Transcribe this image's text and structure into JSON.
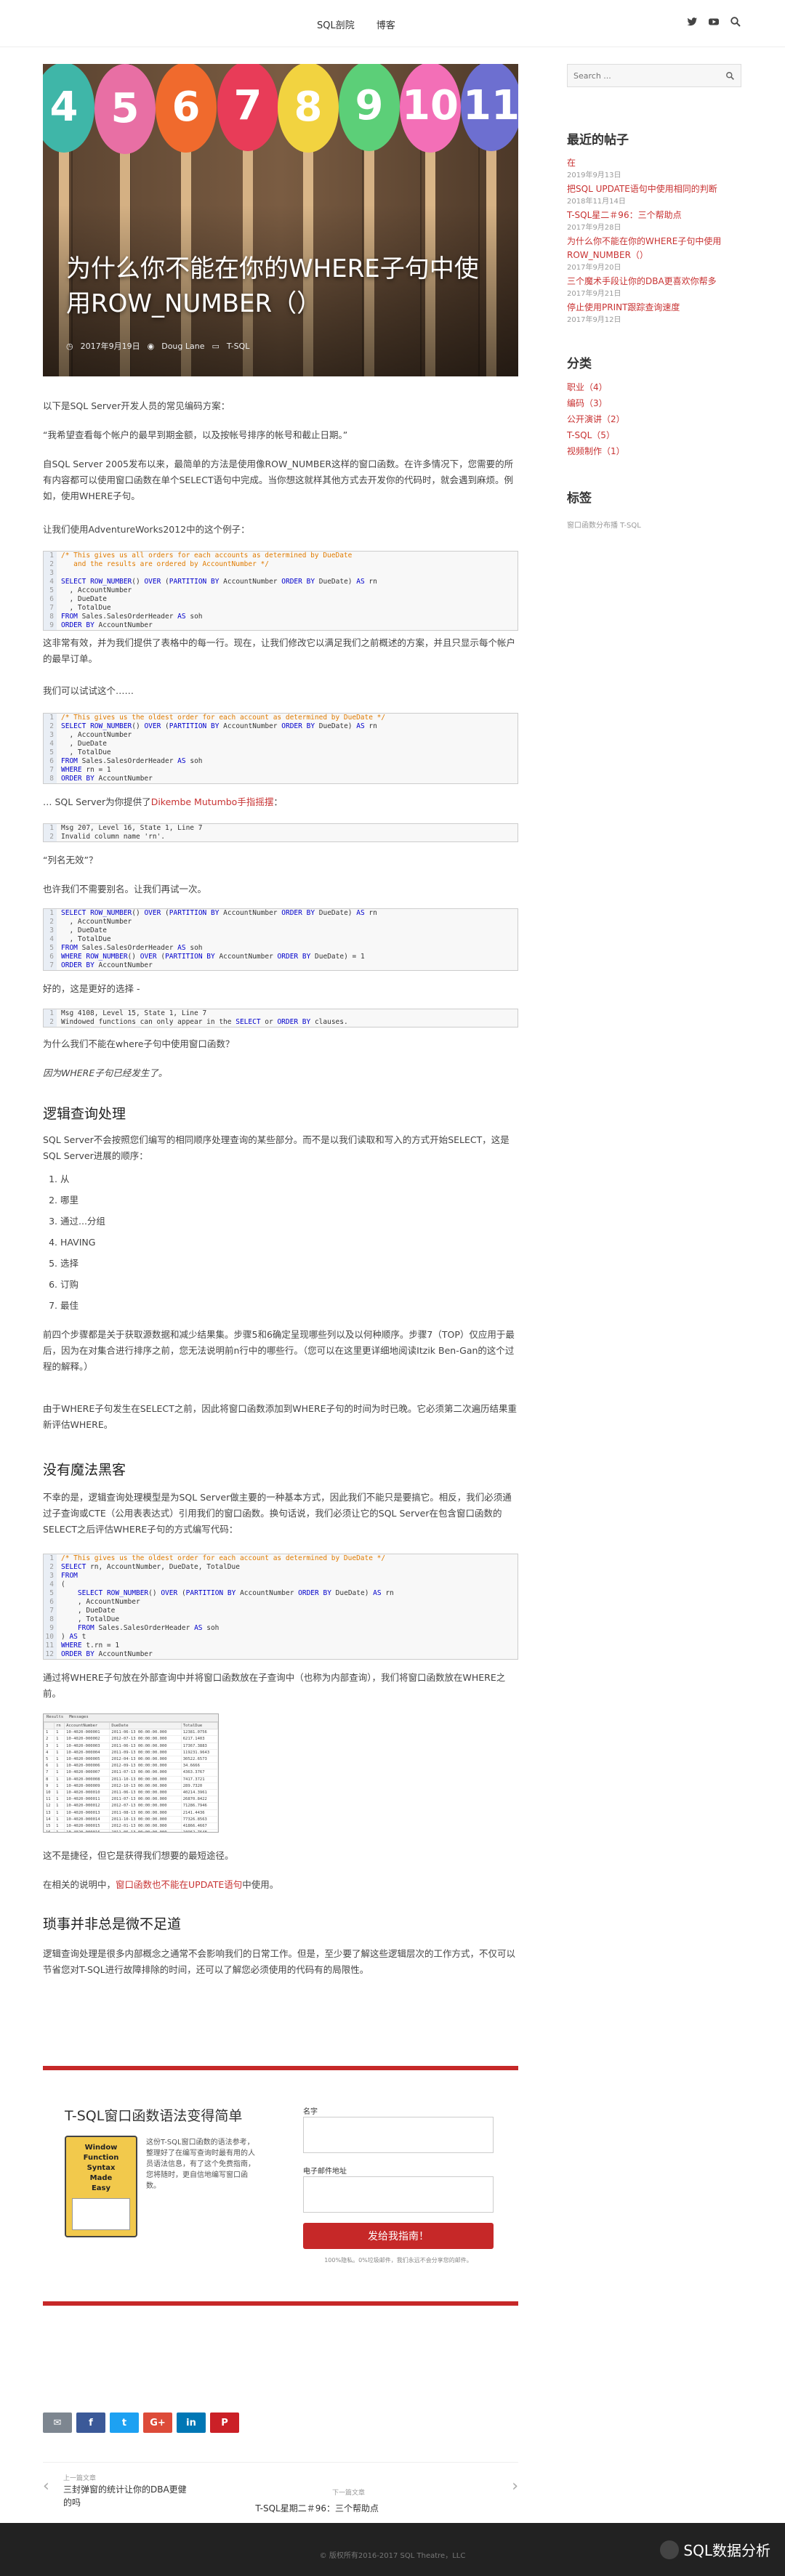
{
  "nav": {
    "items": [
      "SQL剖院",
      "博客"
    ]
  },
  "social": [
    "twitter-icon",
    "youtube-icon",
    "search-icon"
  ],
  "hero": {
    "title": "为什么你不能在你的WHERE子句中使用ROW_NUMBER（）",
    "date": "2017年9月19日",
    "author": "Doug Lane",
    "category": "T-SQL"
  },
  "article": {
    "p1": "以下是SQL Server开发人员的常见编码方案：",
    "p2": "“我希望查看每个帐户的最早到期金额，以及按帐号排序的帐号和截止日期。”",
    "p3": "自SQL Server 2005发布以来，最简单的方法是使用像ROW_NUMBER这样的窗口函数。在许多情况下，您需要的所有内容都可以使用窗口函数在单个SELECT语句中完成。当你想这就样其他方式去开发你的代码时，就会遇到麻烦。例如，使用WHERE子句。",
    "p4": "让我们使用AdventureWorks2012中的这个例子：",
    "code1": [
      "/* This gives us all orders for each accounts as determined by DueDate",
      "   and the results are ordered by AccountNumber */",
      "",
      "SELECT ROW_NUMBER() OVER (PARTITION BY AccountNumber ORDER BY DueDate) AS rn",
      "  , AccountNumber",
      "  , DueDate",
      "  , TotalDue",
      "FROM Sales.SalesOrderHeader AS soh",
      "ORDER BY AccountNumber"
    ],
    "p5": "这非常有效，并为我们提供了表格中的每一行。现在，让我们修改它以满足我们之前概述的方案，并且只显示每个帐户的最早订单。",
    "p6": "我们可以试试这个……",
    "code2": [
      "/* This gives us the oldest order for each account as determined by DueDate */",
      "SELECT ROW_NUMBER() OVER (PARTITION BY AccountNumber ORDER BY DueDate) AS rn",
      "  , AccountNumber",
      "  , DueDate",
      "  , TotalDue",
      "FROM Sales.SalesOrderHeader AS soh",
      "WHERE rn = 1",
      "ORDER BY AccountNumber"
    ],
    "p7a": "… SQL Server为你提供了",
    "p7link": "Dikembe Mutumbo手指摇摆",
    "p7b": "：",
    "code3": [
      "Msg 207, Level 16, State 1, Line 7",
      "Invalid column name 'rn'."
    ],
    "p8": "“列名无效”？",
    "p9": "也许我们不需要别名。让我们再试一次。",
    "code4": [
      "SELECT ROW_NUMBER() OVER (PARTITION BY AccountNumber ORDER BY DueDate) AS rn",
      "  , AccountNumber",
      "  , DueDate",
      "  , TotalDue",
      "FROM Sales.SalesOrderHeader AS soh",
      "WHERE ROW_NUMBER() OVER (PARTITION BY AccountNumber ORDER BY DueDate) = 1",
      "ORDER BY AccountNumber"
    ],
    "p10": "好的，这是更好的选择 -",
    "code5": [
      "Msg 4108, Level 15, State 1, Line 7",
      "Windowed functions can only appear in the SELECT or ORDER BY clauses."
    ],
    "p11": "为什么我们不能在where子句中使用窗口函数？",
    "p12": "因为WHERE子句已经发生了。",
    "h_logic": "逻辑查询处理",
    "p13": "SQL Server不会按照您们编写的相同顺序处理查询的某些部分。而不是以我们读取和写入的方式开始SELECT，这是SQL Server进展的顺序：",
    "order": [
      "从",
      "哪里",
      "通过...分组",
      "HAVING",
      "选择",
      "订购",
      "最佳"
    ],
    "p14": "前四个步骤都是关于获取源数据和减少结果集。步骤5和6确定呈现哪些列以及以何种顺序。步骤7（TOP）仅应用于最后，因为在对集合进行排序之前，您无法说明前n行中的哪些行。（您可以在这里更详细地阅读Itzik Ben-Gan的这个过程的解释。）",
    "p15": "由于WHERE子句发生在SELECT之前，因此将窗口函数添加到WHERE子句的时间为时已晚。它必须第二次遍历结果重新评估WHERE。",
    "h_magic": "没有魔法黑客",
    "p16": "不幸的是，逻辑查询处理模型是为SQL Server做主要的一种基本方式，因此我们不能只是要搞它。相反，我们必须通过子查询或CTE（公用表表达式）引用我们的窗口函数。换句话说，我们必须让它的SQL Server在包含窗口函数的SELECT之后评估WHERE子句的方式编写代码：",
    "code6": [
      "/* This gives us the oldest order for each account as determined by DueDate */",
      "SELECT rn, AccountNumber, DueDate, TotalDue",
      "FROM",
      "(",
      "    SELECT ROW_NUMBER() OVER (PARTITION BY AccountNumber ORDER BY DueDate) AS rn",
      "    , AccountNumber",
      "    , DueDate",
      "    , TotalDue",
      "    FROM Sales.SalesOrderHeader AS soh",
      ") AS t",
      "WHERE t.rn = 1",
      "ORDER BY AccountNumber"
    ],
    "p17": "通过将WHERE子句放在外部查询中并将窗口函数放在子查询中（也称为内部查询），我们将窗口函数放在WHERE之前。",
    "results": {
      "tabs": [
        "Results",
        "Messages"
      ],
      "headers": [
        "",
        "rn",
        "AccountNumber",
        "DueDate",
        "TotalDue"
      ],
      "rows": [
        [
          "1",
          "1",
          "10-4020-000001",
          "2011-06-13 00:00:00.000",
          "12381.0756"
        ],
        [
          "2",
          "1",
          "10-4020-000002",
          "2012-07-13 00:00:00.000",
          "6217.1403"
        ],
        [
          "3",
          "1",
          "10-4020-000003",
          "2011-06-13 00:00:00.000",
          "17367.3883"
        ],
        [
          "4",
          "1",
          "10-4020-000004",
          "2011-09-13 00:00:00.000",
          "119231.9643"
        ],
        [
          "5",
          "1",
          "10-4020-000005",
          "2012-04-13 00:00:00.000",
          "30522.6573"
        ],
        [
          "6",
          "1",
          "10-4020-000006",
          "2012-09-13 00:00:00.000",
          "34.6666"
        ],
        [
          "7",
          "1",
          "10-4020-000007",
          "2011-07-13 00:00:00.000",
          "4363.3767"
        ],
        [
          "8",
          "1",
          "10-4020-000008",
          "2011-10-13 00:00:00.000",
          "7417.3721"
        ],
        [
          "9",
          "1",
          "10-4020-000009",
          "2012-10-13 00:00:00.000",
          "289.7320"
        ],
        [
          "10",
          "1",
          "10-4020-000010",
          "2011-06-13 00:00:00.000",
          "40214.3961"
        ],
        [
          "11",
          "1",
          "10-4020-000011",
          "2011-07-13 00:00:00.000",
          "26870.8422"
        ],
        [
          "12",
          "1",
          "10-4020-000012",
          "2012-07-13 00:00:00.000",
          "71286.7946"
        ],
        [
          "13",
          "1",
          "10-4020-000013",
          "2011-08-13 00:00:00.000",
          "2141.4436"
        ],
        [
          "14",
          "1",
          "10-4020-000014",
          "2011-10-13 00:00:00.000",
          "77326.8563"
        ],
        [
          "15",
          "1",
          "10-4020-000015",
          "2012-01-13 00:00:00.000",
          "41866.4667"
        ],
        [
          "16",
          "1",
          "10-4020-000016",
          "2011-06-13 00:00:00.000",
          "10962.7648"
        ]
      ]
    },
    "p18": "这不是捷径，但它是获得我们想要的最短途径。",
    "p19a": "在相关的说明中，",
    "p19link": "窗口函数也不能在UPDATE语句",
    "p19b": "中使用。",
    "h_tidy": "琐事并非总是微不足道",
    "p20": "逻辑查询处理是很多内部概念之通常不会影响我们的日常工作。但是，至少要了解这些逻辑层次的工作方式，不仅可以节省您对T-SQL进行故障排除的时间，还可以了解您必须使用的代码有的局限性。"
  },
  "newsletter": {
    "title": "T-SQL窗口函数语法变得简单",
    "book_lines": [
      "Window",
      "Function",
      "Syntax",
      "Made",
      "Easy"
    ],
    "desc": "这份T-SQL窗口函数的语法参考，整理好了在编写查询时最有用的人员语法信息，有了这个免费指南，您将随时，更自信地编写窗口函数。",
    "name_label": "名字",
    "email_label": "电子邮件地址",
    "cta": "发给我指南！",
    "privacy": "100%隐私。0%垃圾邮件，我们永远不会分享您的邮件。"
  },
  "share_buttons": [
    {
      "label": "✉",
      "color": "#7d8690"
    },
    {
      "label": "f",
      "color": "#3b5998"
    },
    {
      "label": "t",
      "color": "#1da1f2"
    },
    {
      "label": "G+",
      "color": "#dd4b39"
    },
    {
      "label": "in",
      "color": "#0077b5"
    },
    {
      "label": "P",
      "color": "#cb2027"
    }
  ],
  "pagination": {
    "prev_label": "上一篇文章",
    "prev_title": "三封弹窗的统计让你的DBA更健的吗",
    "next_label": "下一篇文章",
    "next_title": "T-SQL星期二＃96：三个帮助点"
  },
  "sidebar": {
    "search_placeholder": "Search ...",
    "recent_title": "最近的帖子",
    "recent": [
      {
        "title": "在",
        "date": "2019年9月13日"
      },
      {
        "title": "把SQL UPDATE语句中使用相同的判断",
        "date": "2018年11月14日"
      },
      {
        "title": "T-SQL星二＃96：三个帮助点",
        "date": "2017年9月28日"
      },
      {
        "title": "为什么你不能在你的WHERE子句中使用ROW_NUMBER（）",
        "date": "2017年9月20日"
      },
      {
        "title": "三个魔术手段让你的DBA更喜欢你帮多",
        "date": "2017年9月21日"
      },
      {
        "title": "停止使用PRINT跟踪查询速度",
        "date": "2017年9月12日"
      }
    ],
    "cat_title": "分类",
    "categories": [
      "职业（4）",
      "编码（3）",
      "公开演讲（2）",
      "T-SQL（5）",
      "视频制作（1）"
    ],
    "tag_title": "标签",
    "tags": "窗口函数分布播 T-SQL"
  },
  "footer": {
    "copy": "© 版权所有2016-2017 SQL Theatre，LLC",
    "watermark": "SQL数据分析"
  },
  "colors": {
    "accent": "#c83232",
    "footer": "#222222"
  }
}
